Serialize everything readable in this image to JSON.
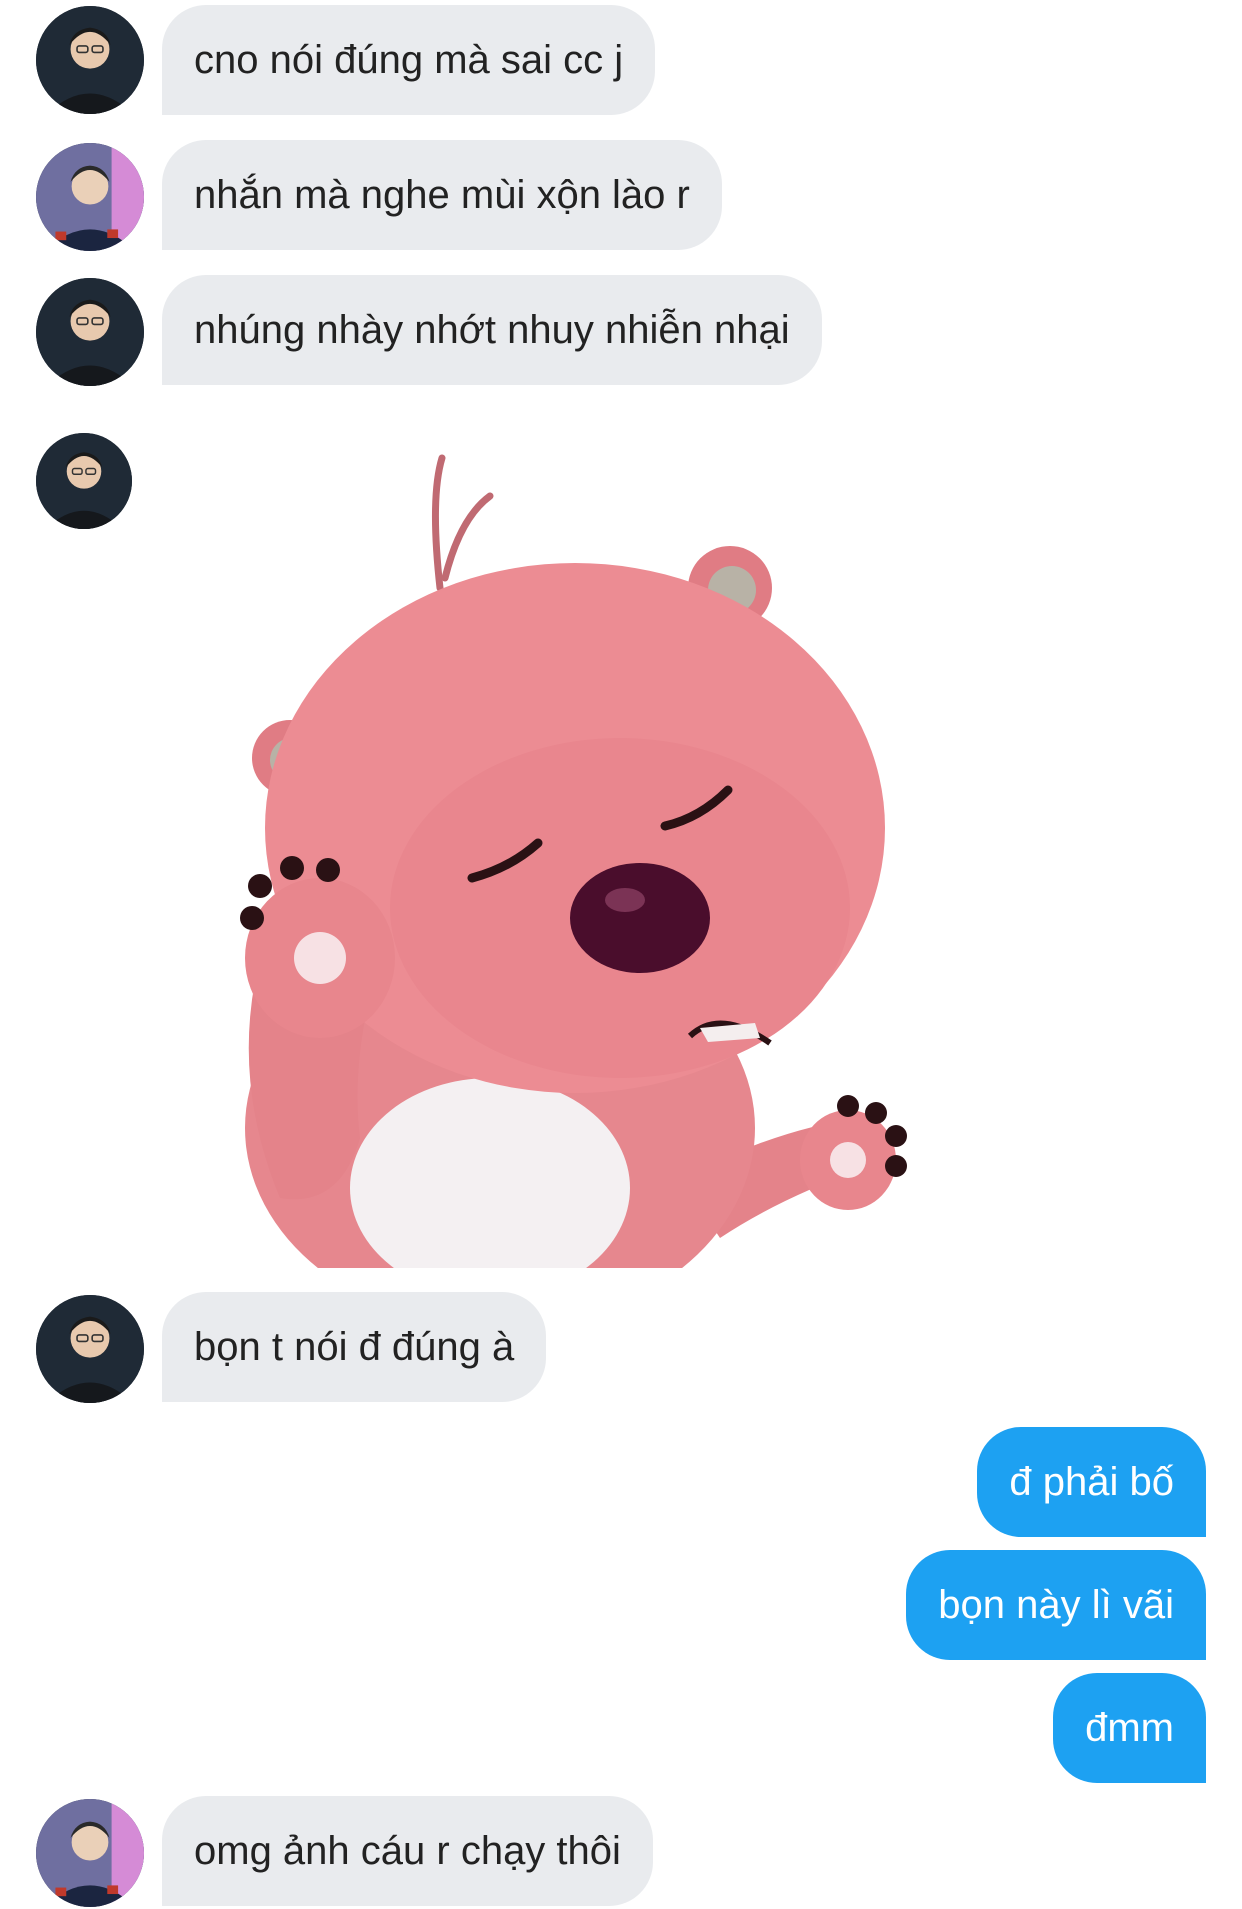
{
  "conversation": {
    "messages": [
      {
        "sender": "them",
        "text": "cno nói đúng mà sai cc j"
      },
      {
        "sender": "them",
        "text": "nhắn mà nghe mùi xộn lào r"
      },
      {
        "sender": "them",
        "text": "nhúng nhày nhớt nhuy nhiễn nhại"
      },
      {
        "sender": "them",
        "type": "sticker",
        "sticker_icon": "pink-beaver-sticker"
      },
      {
        "sender": "them",
        "text": "bọn t nói đ đúng à"
      },
      {
        "sender": "me",
        "text": "đ phải bố"
      },
      {
        "sender": "me",
        "text": "bọn này lì vãi"
      },
      {
        "sender": "me",
        "text": "đmm"
      },
      {
        "sender": "them",
        "text": "omg ảnh cáu r chạy thôi"
      }
    ]
  },
  "colors": {
    "incoming_bubble": "#e9ebee",
    "outgoing_bubble": "#1da1f2",
    "incoming_text": "#222222",
    "outgoing_text": "#ffffff"
  }
}
